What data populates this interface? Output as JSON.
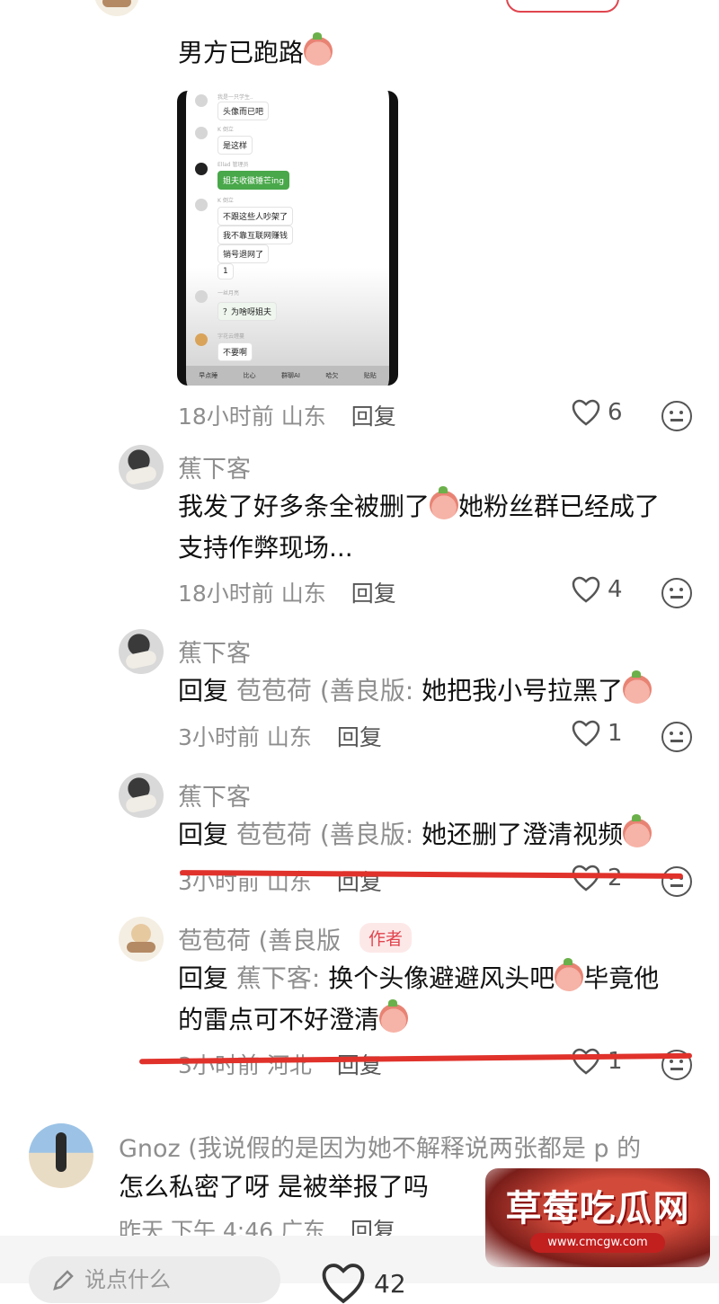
{
  "thread": {
    "top_text": "男方已跑路",
    "top_meta": {
      "time": "18小时前",
      "location": "山东",
      "reply": "回复",
      "likes": "6"
    },
    "chat_shot": {
      "names": [
        "我是一只学生..",
        "K 倒立",
        "Ellad 管理员",
        "K 倒立",
        "一丝月亮",
        "字花云缠蔓"
      ],
      "messages": [
        "头像而已吧",
        "是这样",
        "姐夫收徽锤芒ing",
        "不跟这些人吵架了",
        "我不靠互联网赚钱",
        "销号退网了",
        "1",
        "？为啥呀姐夫",
        "不要啊"
      ],
      "toolbar": [
        "早点睡",
        "比心",
        "群聊AI",
        "哈欠",
        "贴贴"
      ]
    }
  },
  "comments": [
    {
      "name": "蕉下客",
      "text": "我发了好多条全被删了",
      "text2": "她粉丝群已经成了",
      "text3": "支持作弊现场...",
      "time": "18小时前",
      "location": "山东",
      "reply": "回复",
      "likes": "4"
    },
    {
      "name": "蕉下客",
      "reply_prefix": "回复",
      "reply_to": "苞苞荷 (善良版:",
      "text": " 她把我小号拉黑了",
      "time": "3小时前",
      "location": "山东",
      "reply": "回复",
      "likes": "1"
    },
    {
      "name": "蕉下客",
      "reply_prefix": "回复",
      "reply_to": "苞苞荷 (善良版:",
      "text": " 她还删了澄清视频",
      "time": "3小时前",
      "location": "山东",
      "reply": "回复",
      "likes": "2"
    },
    {
      "name": "苞苞荷 (善良版",
      "tag": "作者",
      "reply_prefix": "回复",
      "reply_to": "蕉下客:",
      "text": " 换个头像避避风头吧",
      "text2": "毕竟他",
      "text3": "的雷点可不好澄清",
      "time": "3小时前",
      "location": "河北",
      "reply": "回复",
      "likes": "1"
    },
    {
      "name": "Gnoz (我说假的是因为她不解释说两张都是 p 的",
      "text": "怎么私密了呀 是被举报了吗",
      "time": "昨天 下午 4:46",
      "location": "广东",
      "reply": "回复"
    }
  ],
  "bottom": {
    "input_placeholder": "说点什么",
    "likes": "42"
  },
  "watermark": {
    "title": "草莓吃瓜网",
    "url": "www.cmcgw.com"
  },
  "colors": {
    "accent": "#e0454e",
    "strike": "#e0322b",
    "meta": "#8e8e8e"
  }
}
